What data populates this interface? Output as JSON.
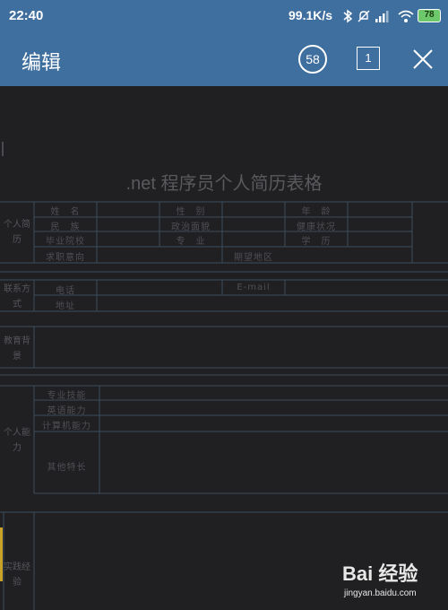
{
  "status_bar": {
    "time": "22:40",
    "net_speed": "99.1K/s",
    "battery": "78",
    "icons": [
      "bluetooth-icon",
      "mute-icon",
      "signal-icon",
      "wifi-icon",
      "battery-icon"
    ]
  },
  "toolbar": {
    "title": "编辑",
    "count_badge": "58",
    "page_indicator": "1",
    "close_icon": "close-icon"
  },
  "document": {
    "title": ".net 程序员个人简历表格",
    "sections": {
      "personal": "个人简历",
      "contact": "联系方式",
      "education": "教育背景",
      "ability": "个人能力",
      "practice": "实践经验"
    },
    "fields": {
      "name": "姓　名",
      "gender": "性　别",
      "age": "年　龄",
      "ethnicity": "民　族",
      "political": "政治面貌",
      "health": "健康状况",
      "school": "毕业院校",
      "major": "专　业",
      "degree": "学　历",
      "job_target": "求职意向",
      "job_region": "期望地区",
      "phone": "电话",
      "email": "E-mail",
      "address": "地址",
      "major_skill": "专业技能",
      "language": "英语能力",
      "computer": "计算机能力",
      "other": "其他特长"
    }
  },
  "watermark": {
    "logo": "Bai 经验",
    "url": "jingyan.baidu.com"
  },
  "colors": {
    "header_bg": "#3f6f9e",
    "doc_bg": "#202022",
    "grid_line": "#3c4d5c",
    "accent_bar": "#c9a227"
  }
}
